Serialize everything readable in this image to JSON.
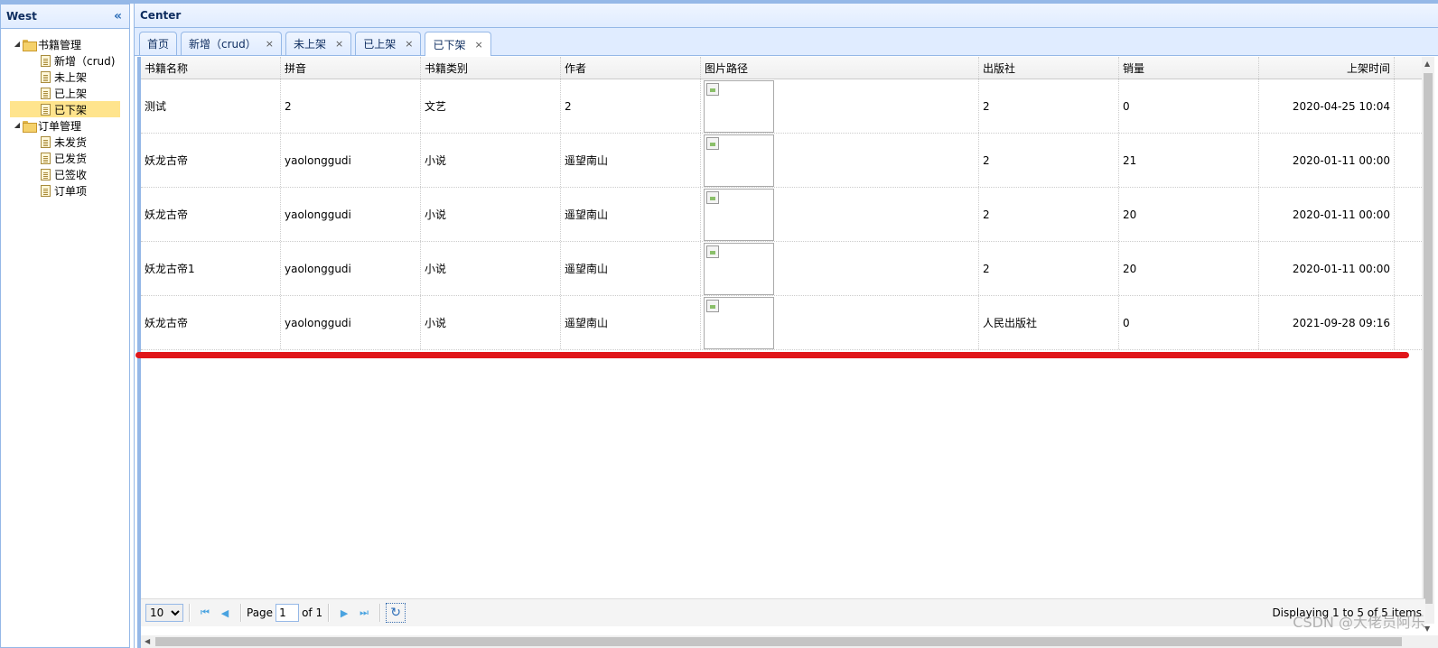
{
  "west": {
    "title": "West",
    "collapse_icon": "«",
    "tree": [
      {
        "label": "书籍管理",
        "type": "folder",
        "level": 0
      },
      {
        "label": "新增（crud)",
        "type": "file",
        "level": 1
      },
      {
        "label": "未上架",
        "type": "file",
        "level": 1
      },
      {
        "label": "已上架",
        "type": "file",
        "level": 1
      },
      {
        "label": "已下架",
        "type": "file",
        "level": 1,
        "selected": true
      },
      {
        "label": "订单管理",
        "type": "folder",
        "level": 0
      },
      {
        "label": "未发货",
        "type": "file",
        "level": 1
      },
      {
        "label": "已发货",
        "type": "file",
        "level": 1
      },
      {
        "label": "已签收",
        "type": "file",
        "level": 1
      },
      {
        "label": "订单项",
        "type": "file",
        "level": 1
      }
    ]
  },
  "center": {
    "title": "Center",
    "tabs": [
      {
        "label": "首页",
        "closable": false
      },
      {
        "label": "新增（crud）",
        "closable": true
      },
      {
        "label": "未上架",
        "closable": true
      },
      {
        "label": "已上架",
        "closable": true
      },
      {
        "label": "已下架",
        "closable": true,
        "active": true
      }
    ],
    "close_glyph": "×"
  },
  "grid": {
    "columns": [
      "书籍名称",
      "拼音",
      "书籍类别",
      "作者",
      "图片路径",
      "出版社",
      "销量",
      "上架时间"
    ],
    "rows": [
      [
        "测试",
        "2",
        "文艺",
        "2",
        "",
        "2",
        "0",
        "2020-04-25 10:04"
      ],
      [
        "妖龙古帝",
        "yaolonggudi",
        "小说",
        "遥望南山",
        "",
        "2",
        "21",
        "2020-01-11 00:00"
      ],
      [
        "妖龙古帝",
        "yaolonggudi",
        "小说",
        "遥望南山",
        "",
        "2",
        "20",
        "2020-01-11 00:00"
      ],
      [
        "妖龙古帝1",
        "yaolonggudi",
        "小说",
        "遥望南山",
        "",
        "2",
        "20",
        "2020-01-11 00:00"
      ],
      [
        "妖龙古帝",
        "yaolonggudi",
        "小说",
        "遥望南山",
        "",
        "人民出版社",
        "0",
        "2021-09-28 09:16"
      ]
    ]
  },
  "pager": {
    "page_size": "10",
    "page_label": "Page",
    "page_value": "1",
    "of_label": "of 1",
    "info": "Displaying 1 to 5 of 5 items"
  },
  "watermark": "CSDN @大佬员阿乐",
  "colors": {
    "border": "#95b8e7",
    "header_bg": "#e0ecff",
    "selected_bg": "#ffe48d",
    "annotation_red": "#e0161a"
  }
}
